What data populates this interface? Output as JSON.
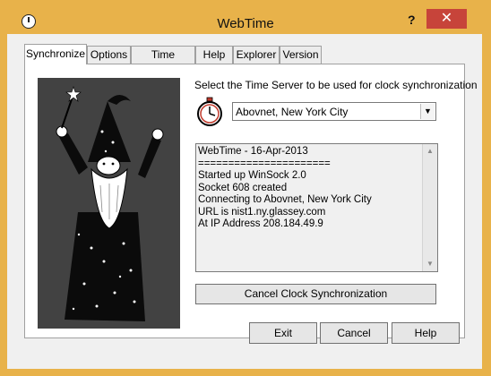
{
  "window": {
    "title": "WebTime",
    "help_glyph": "?",
    "close_glyph": "✕"
  },
  "tabs": [
    {
      "label": "Synchronize",
      "active": true
    },
    {
      "label": "Options",
      "active": false
    },
    {
      "label": "Time Servers",
      "active": false
    },
    {
      "label": "Help",
      "active": false
    },
    {
      "label": "Explorer",
      "active": false
    },
    {
      "label": "Version",
      "active": false
    }
  ],
  "synchronize": {
    "prompt": "Select the Time Server to be used for clock synchronization",
    "selected_server": "Abovnet, New York City",
    "log_lines": [
      "WebTime - 16-Apr-2013",
      "======================",
      "Started up WinSock 2.0",
      "Socket 608 created",
      "Connecting to Abovnet, New York City",
      "URL is nist1.ny.glassey.com",
      "At IP Address 208.184.49.9"
    ],
    "cancel_label": "Cancel Clock Synchronization"
  },
  "buttons": {
    "exit": "Exit",
    "cancel": "Cancel",
    "help": "Help"
  },
  "colors": {
    "title_bar": "#e8b24a",
    "close_button": "#c7443a",
    "illustration_bg": "#424242"
  },
  "icons": [
    "stopwatch-icon",
    "wizard-illustration",
    "chevron-down-icon",
    "close-icon",
    "help-icon"
  ]
}
